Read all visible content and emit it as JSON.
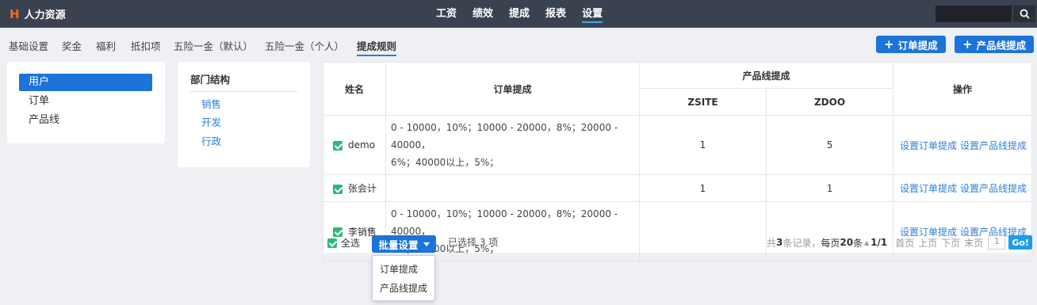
{
  "app": {
    "logo_letter": "H",
    "title": "人力资源"
  },
  "mainnav": [
    "工资",
    "绩效",
    "提成",
    "报表",
    "设置"
  ],
  "search": {
    "placeholder": ""
  },
  "subnav": [
    "基础设置",
    "奖金",
    "福利",
    "抵扣项",
    "五险一金（默认）",
    "五险一金（个人）",
    "提成规则"
  ],
  "actions": {
    "order_commission": "订单提成",
    "product_commission": "产品线提成"
  },
  "left_menu": [
    "用户",
    "订单",
    "产品线"
  ],
  "dept": {
    "title": "部门结构",
    "items": [
      "销售",
      "开发",
      "行政"
    ]
  },
  "table": {
    "headers": {
      "name": "姓名",
      "order": "订单提成",
      "product": "产品线提成",
      "zsite": "ZSITE",
      "zdoo": "ZDOO",
      "ops": "操作"
    },
    "rows": [
      {
        "name": "demo",
        "rule_line1": "0 - 10000，10%；10000 - 20000，8%；20000 - 40000，",
        "rule_line2": "6%；40000以上，5%；",
        "zsite": "1",
        "zdoo": "5"
      },
      {
        "name": "张会计",
        "rule_line1": "",
        "rule_line2": "",
        "zsite": "1",
        "zdoo": "1"
      },
      {
        "name": "李销售",
        "rule_line1": "0 - 10000，10%；10000 - 20000，8%；20000 - 40000，",
        "rule_line2": "6%；40000以上，5%；",
        "zsite": "",
        "zdoo": ""
      }
    ],
    "op_order": "设置订单提成",
    "op_product": "设置产品线提成"
  },
  "footer": {
    "select_all": "全选",
    "batch": "批量设置",
    "selected": "已选择 3 项",
    "total_prefix": "共",
    "total": "3",
    "total_suffix": "条记录，",
    "per_page_prefix": "每页",
    "per_page": "20",
    "per_page_suffix": "条",
    "page_info": "1/1",
    "first": "首页",
    "prev": "上页",
    "next": "下页",
    "last": "末页",
    "page_input": "1",
    "go": "Go!"
  },
  "dropdown": [
    "订单提成",
    "产品线提成"
  ],
  "colors": {
    "primary": "#1c73d8",
    "topbar": "#3a4250",
    "check": "#2cb87b",
    "link": "#2e7fd6"
  }
}
